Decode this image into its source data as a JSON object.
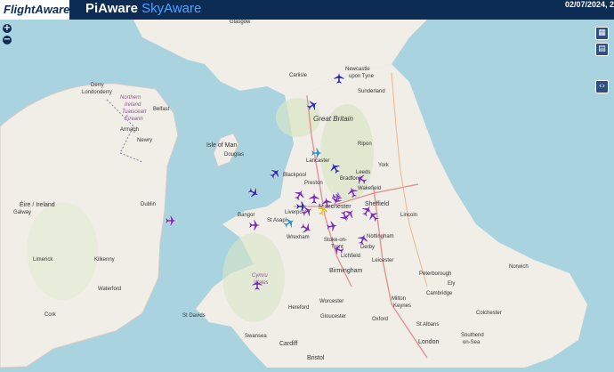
{
  "header": {
    "logo": "FlightAware",
    "title_pi": "PiAware",
    "title_sky": "SkyAware",
    "datetime": "02/07/2024, 2"
  },
  "controls": {
    "zoom_in": "+",
    "zoom_out": "−"
  },
  "map": {
    "labels": {
      "glasgow": "Glasgow",
      "newcastle_1": "Newcastle",
      "newcastle_2": "upon Tyne",
      "carlisle": "Carlisle",
      "sunderland": "Sunderland",
      "great_britain": "Great Britain",
      "derry": "Derry",
      "londonderry": "Londonderry",
      "northern_ireland_1": "Northern",
      "northern_ireland_2": "Ireland",
      "northern_ireland_3": "Tuaisceart",
      "northern_ireland_4": "Éireann",
      "belfast": "Belfast",
      "armagh": "Armagh",
      "newry": "Newry",
      "isle_of_man": "Isle of Man",
      "douglas": "Douglas",
      "ripon": "Ripon",
      "lancaster": "Lancaster",
      "leeds": "Leeds",
      "york": "York",
      "preston": "Preston",
      "wakefield": "Wakefield",
      "blackpool": "Blackpool",
      "bradford": "Bradford",
      "manchester": "Manchester",
      "sheffield": "Sheffield",
      "liverpool": "Liverpool",
      "lincoln": "Lincoln",
      "eire": "Éire / Ireland",
      "galway": "Galway",
      "dublin": "Dublin",
      "bangor": "Bangor",
      "st_asaph": "St Asaph",
      "wrexham": "Wrexham",
      "stoke": "Stoke-on-",
      "trent": "Trent",
      "nottingham": "Nottingham",
      "derby": "Derby",
      "lichfield": "Lichfield",
      "leicester": "Leicester",
      "norwich": "Norwich",
      "limerick": "Limerick",
      "kilkenny": "Kilkenny",
      "waterford": "Waterford",
      "birmingham": "Birmingham",
      "peterborough": "Peterborough",
      "cymru": "Cymru",
      "wales": "Wales",
      "ely": "Ely",
      "cambridge": "Cambridge",
      "hereford": "Hereford",
      "worcester": "Worcester",
      "milton_keynes_1": "Milton",
      "milton_keynes_2": "Keynes",
      "cork": "Cork",
      "st_davids": "St Davids",
      "gloucester": "Gloucester",
      "oxford": "Oxford",
      "colchester": "Colchester",
      "swansea": "Swansea",
      "st_albans": "St Albans",
      "cardiff": "Cardiff",
      "london": "London",
      "southend_1": "Southend",
      "southend_2": "on-Sea",
      "bristol": "Bristol"
    },
    "aircraft_count": 28,
    "colors": {
      "sea": "#a9d3df",
      "land": "#f1eee8",
      "aircraft_purple": "#7a2fb0",
      "aircraft_blue": "#2a2db0",
      "aircraft_cyan": "#2f8fbf",
      "aircraft_yellow": "#d8c020"
    }
  }
}
